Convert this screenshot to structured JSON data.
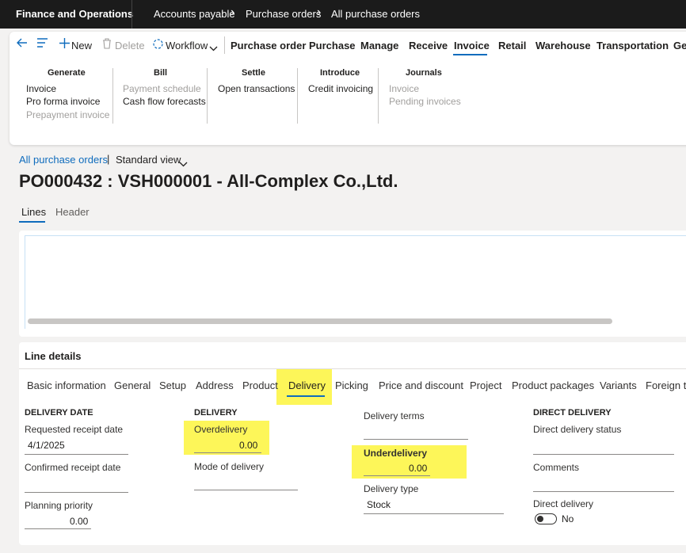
{
  "topbar": {
    "app_title": "Finance and Operations",
    "breadcrumbs": [
      "Accounts payable",
      "Purchase orders",
      "All purchase orders"
    ]
  },
  "toolbar": {
    "new_label": "New",
    "delete_label": "Delete",
    "workflow_label": "Workflow",
    "tabs": [
      "Purchase order",
      "Purchase",
      "Manage",
      "Receive",
      "Invoice",
      "Retail",
      "Warehouse",
      "Transportation",
      "Ge"
    ],
    "active_tab": "Invoice"
  },
  "ribbon": {
    "groups": [
      {
        "title": "Generate",
        "items": [
          "Invoice",
          "Pro forma invoice",
          "Prepayment invoice"
        ]
      },
      {
        "title": "Bill",
        "items": [
          "Payment schedule",
          "Cash flow forecasts"
        ]
      },
      {
        "title": "Settle",
        "items": [
          "Open transactions"
        ]
      },
      {
        "title": "Introduce",
        "items": [
          "Credit invoicing"
        ]
      },
      {
        "title": "Journals",
        "items": [
          "Invoice",
          "Pending invoices"
        ]
      }
    ]
  },
  "page": {
    "breadcrumb_link": "All purchase orders",
    "view_label": "Standard view",
    "title": "PO000432 : VSH000001 - All-Complex Co.,Ltd.",
    "tabs": [
      "Lines",
      "Header"
    ]
  },
  "line_details": {
    "title": "Line details",
    "tabs": [
      "Basic information",
      "General",
      "Setup",
      "Address",
      "Product",
      "Delivery",
      "Picking",
      "Price and discount",
      "Project",
      "Product packages",
      "Variants",
      "Foreign tr"
    ],
    "active_tab": "Delivery",
    "delivery_date": {
      "section": "DELIVERY DATE",
      "requested_label": "Requested receipt date",
      "requested_value": "4/1/2025",
      "confirmed_label": "Confirmed receipt date",
      "confirmed_value": "",
      "planning_label": "Planning priority",
      "planning_value": "0.00"
    },
    "delivery": {
      "section": "DELIVERY",
      "overdelivery_label": "Overdelivery",
      "overdelivery_value": "0.00",
      "mode_label": "Mode of delivery",
      "mode_value": ""
    },
    "terms": {
      "terms_label": "Delivery terms",
      "terms_value": "",
      "underdelivery_label": "Underdelivery",
      "underdelivery_value": "0.00",
      "type_label": "Delivery type",
      "type_value": "Stock"
    },
    "direct_delivery": {
      "section": "DIRECT DELIVERY",
      "status_label": "Direct delivery status",
      "comments_label": "Comments",
      "toggle_label": "Direct delivery",
      "toggle_value": "No"
    }
  },
  "colors": {
    "accent": "#0f6cbd",
    "highlight": "#fdf659",
    "topbar": "#1b1b1b"
  }
}
